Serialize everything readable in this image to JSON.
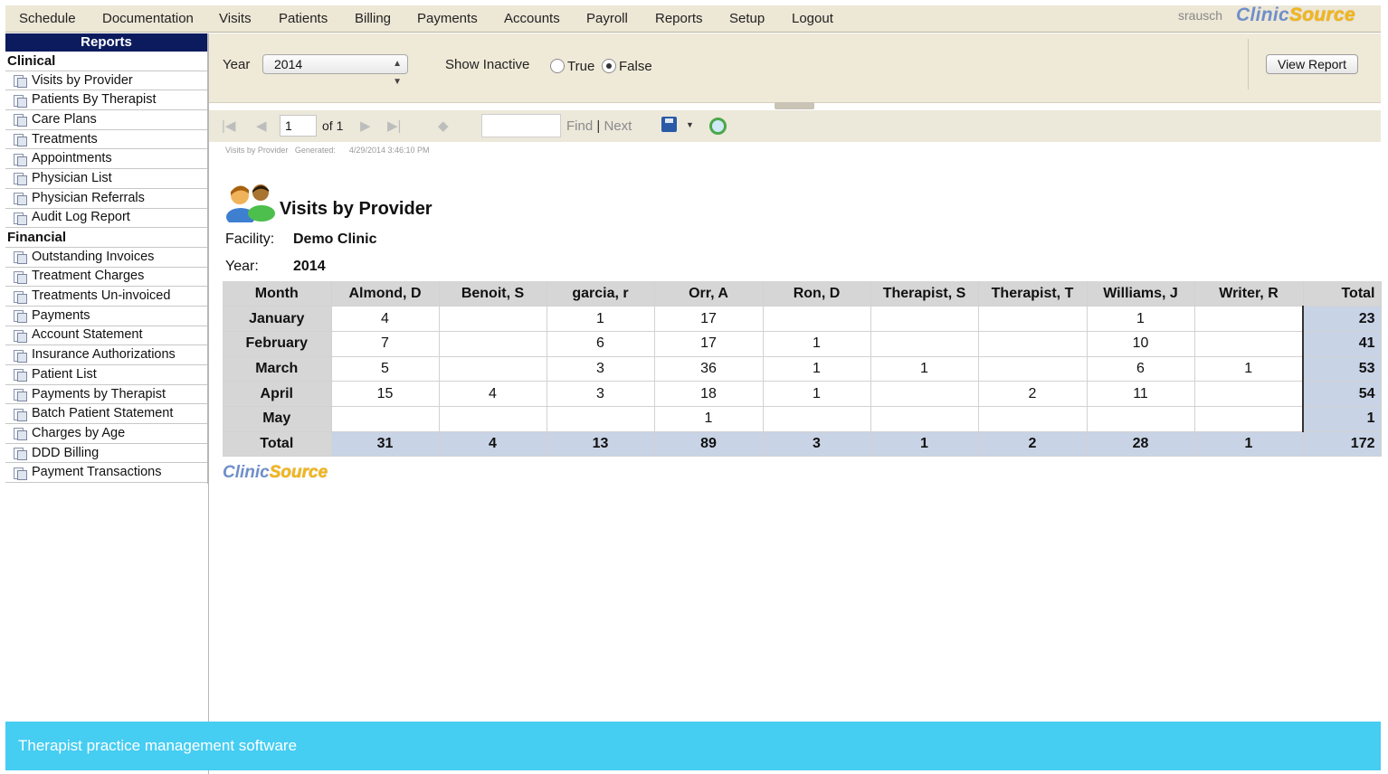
{
  "nav": {
    "items": [
      "Schedule",
      "Documentation",
      "Visits",
      "Patients",
      "Billing",
      "Payments",
      "Accounts",
      "Payroll",
      "Reports",
      "Setup",
      "Logout"
    ],
    "user": "srausch",
    "logo": {
      "part1": "Clinic",
      "part2": "Source"
    }
  },
  "sidebar": {
    "title": "Reports",
    "clinical_label": "Clinical",
    "clinical": [
      "Visits by Provider",
      "Patients By Therapist",
      "Care Plans",
      "Treatments",
      "Appointments",
      "Physician List",
      "Physician Referrals",
      "Audit Log Report"
    ],
    "financial_label": "Financial",
    "financial": [
      "Outstanding Invoices",
      "Treatment Charges",
      "Treatments Un-invoiced",
      "Payments",
      "Account Statement",
      "Insurance Authorizations",
      "Patient List",
      "Payments by Therapist",
      "Batch Patient Statement",
      "Charges by Age",
      "DDD Billing",
      "Payment Transactions"
    ]
  },
  "params": {
    "year_label": "Year",
    "year_value": "2014",
    "show_inactive_label": "Show Inactive",
    "true_label": "True",
    "false_label": "False",
    "selected": "False",
    "view_button": "View Report"
  },
  "toolbar": {
    "page": "1",
    "of_pages": "of 1",
    "find": "Find",
    "separator": "|",
    "next": "Next"
  },
  "report": {
    "meta_name": "Visits by Provider",
    "meta_generated_label": "Generated:",
    "meta_generated": "4/29/2014 3:46:10 PM",
    "title": "Visits by Provider",
    "facility_label": "Facility:",
    "facility": "Demo Clinic",
    "year_label": "Year:",
    "year": "2014",
    "table": {
      "headers": [
        "Month",
        "Almond, D",
        "Benoit, S",
        "garcia, r",
        "Orr, A",
        "Ron, D",
        "Therapist, S",
        "Therapist, T",
        "Williams, J",
        "Writer, R",
        "Total"
      ],
      "rows": [
        {
          "month": "January",
          "cells": [
            "4",
            "",
            "1",
            "17",
            "",
            "",
            "",
            "1",
            ""
          ],
          "total": "23"
        },
        {
          "month": "February",
          "cells": [
            "7",
            "",
            "6",
            "17",
            "1",
            "",
            "",
            "10",
            ""
          ],
          "total": "41"
        },
        {
          "month": "March",
          "cells": [
            "5",
            "",
            "3",
            "36",
            "1",
            "1",
            "",
            "6",
            "1"
          ],
          "total": "53"
        },
        {
          "month": "April",
          "cells": [
            "15",
            "4",
            "3",
            "18",
            "1",
            "",
            "2",
            "11",
            ""
          ],
          "total": "54"
        },
        {
          "month": "May",
          "cells": [
            "",
            "",
            "",
            "1",
            "",
            "",
            "",
            "",
            ""
          ],
          "total": "1"
        }
      ],
      "totals": {
        "label": "Total",
        "cells": [
          "31",
          "4",
          "13",
          "89",
          "3",
          "1",
          "2",
          "28",
          "1"
        ],
        "total": "172"
      }
    },
    "footer_logo": {
      "part1": "Clinic",
      "part2": "Source"
    }
  },
  "caption": "Therapist practice management software",
  "colors": {
    "nav_bg": "#ede7d6",
    "sidebar_header": "#0b1b5e",
    "total_cell": "#c9d3e6",
    "header_cell": "#d6d6d6",
    "caption_bg": "#45cdf2",
    "logo_blue": "#6f8fc9",
    "logo_gold": "#f2b61d"
  }
}
